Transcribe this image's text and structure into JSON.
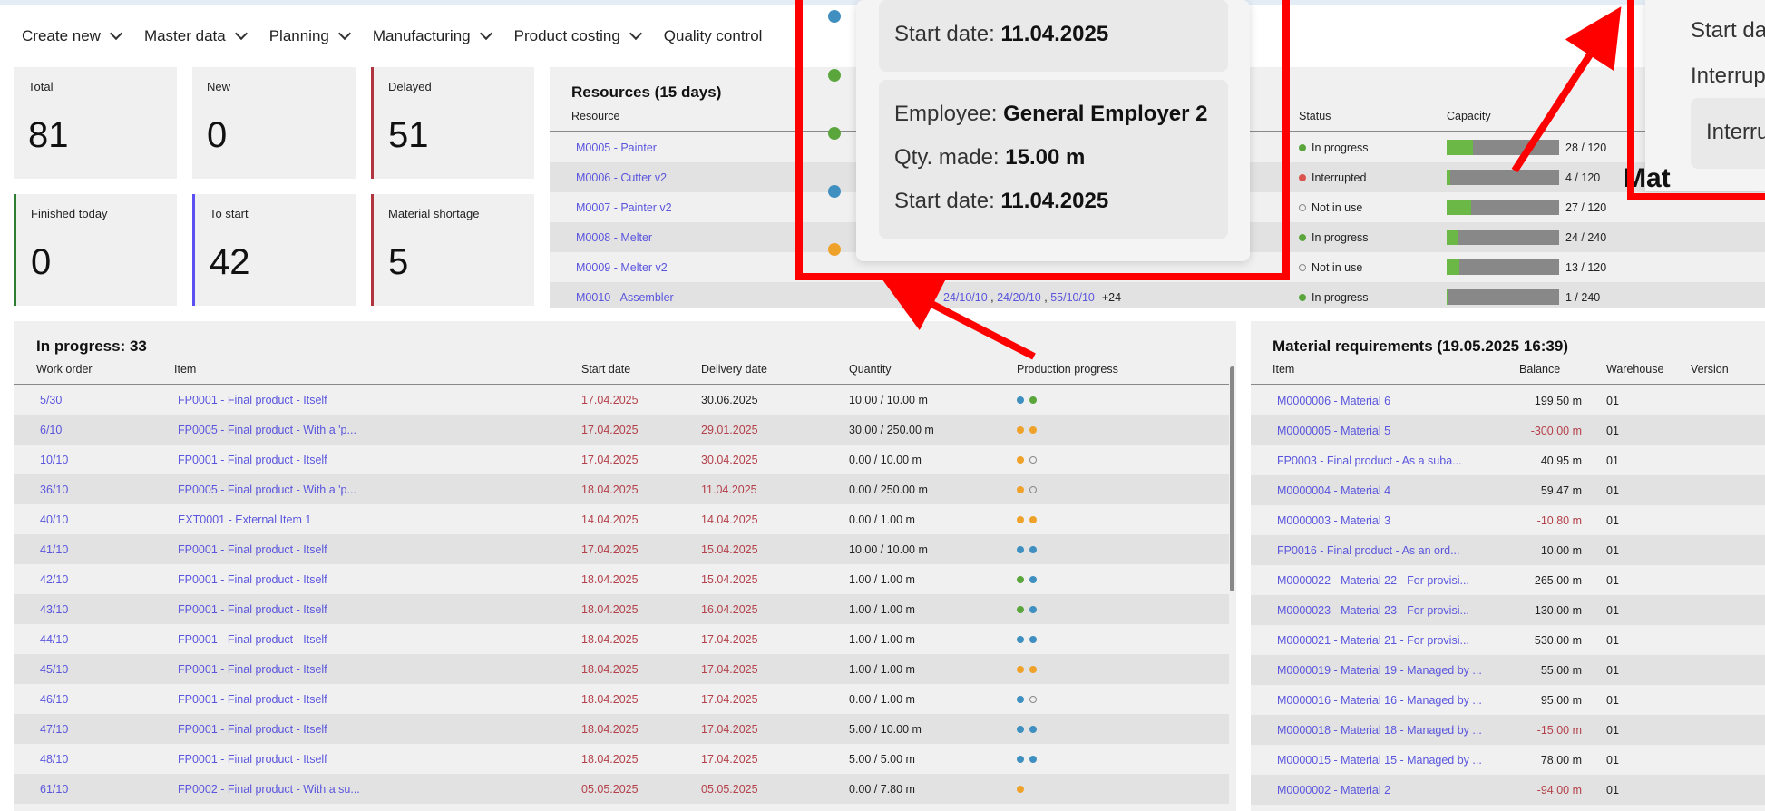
{
  "nav": {
    "items": [
      {
        "label": "Create new"
      },
      {
        "label": "Master data"
      },
      {
        "label": "Planning"
      },
      {
        "label": "Manufacturing"
      },
      {
        "label": "Product costing"
      },
      {
        "label": "Quality control"
      }
    ]
  },
  "kpis": {
    "total": {
      "label": "Total",
      "value": "81"
    },
    "new": {
      "label": "New",
      "value": "0"
    },
    "delayed": {
      "label": "Delayed",
      "value": "51"
    },
    "finished_today": {
      "label": "Finished today",
      "value": "0"
    },
    "to_start": {
      "label": "To start",
      "value": "42"
    },
    "material_shortage": {
      "label": "Material shortage",
      "value": "5"
    }
  },
  "resources": {
    "title": "Resources (15 days)",
    "headers": {
      "resource": "Resource",
      "status": "Status",
      "capacity": "Capacity"
    },
    "rows": [
      {
        "name": "M0005 - Painter",
        "status": "In progress",
        "status_color": "green",
        "capacity": "28 / 120",
        "fill": 0.23
      },
      {
        "name": "M0006 - Cutter v2",
        "status": "Interrupted",
        "status_color": "red",
        "capacity": "4 / 120",
        "fill": 0.03
      },
      {
        "name": "M0007 - Painter v2",
        "status": "Not in use",
        "status_color": "empty",
        "capacity": "27 / 120",
        "fill": 0.22
      },
      {
        "name": "M0008 - Melter",
        "status": "In progress",
        "status_color": "green",
        "capacity": "24 / 240",
        "fill": 0.1
      },
      {
        "name": "M0009 - Melter v2",
        "status": "Not in use",
        "status_color": "empty",
        "capacity": "13 / 120",
        "fill": 0.11
      },
      {
        "name": "M0010 - Assembler",
        "status": "In progress",
        "status_color": "green",
        "capacity": "1 / 240",
        "fill": 0.004
      }
    ],
    "last_row_orders": [
      "24/10/10",
      "24/20/10",
      "55/10/10"
    ],
    "last_row_more": "+24"
  },
  "in_progress": {
    "title": "In progress: 33",
    "headers": {
      "work_order": "Work order",
      "item": "Item",
      "start_date": "Start date",
      "delivery_date": "Delivery date",
      "quantity": "Quantity",
      "progress": "Production progress"
    },
    "rows": [
      {
        "wo": "5/30",
        "item": "FP0001 - Final product - Itself",
        "start": "17.04.2025",
        "start_red": true,
        "delivery": "30.06.2025",
        "delivery_red": false,
        "qty": "10.00 / 10.00 m",
        "dots": [
          "blue",
          "green"
        ]
      },
      {
        "wo": "6/10",
        "item": "FP0005 - Final product - With a 'p...",
        "start": "17.04.2025",
        "start_red": true,
        "delivery": "29.01.2025",
        "delivery_red": true,
        "qty": "30.00 / 250.00 m",
        "dots": [
          "orange",
          "orange"
        ]
      },
      {
        "wo": "10/10",
        "item": "FP0001 - Final product - Itself",
        "start": "17.04.2025",
        "start_red": true,
        "delivery": "30.04.2025",
        "delivery_red": true,
        "qty": "0.00 / 10.00 m",
        "dots": [
          "orange",
          "empty"
        ]
      },
      {
        "wo": "36/10",
        "item": "FP0005 - Final product - With a 'p...",
        "start": "18.04.2025",
        "start_red": true,
        "delivery": "11.04.2025",
        "delivery_red": true,
        "qty": "0.00 / 250.00 m",
        "dots": [
          "orange",
          "empty"
        ]
      },
      {
        "wo": "40/10",
        "item": "EXT0001 - External Item 1",
        "start": "14.04.2025",
        "start_red": true,
        "delivery": "14.04.2025",
        "delivery_red": true,
        "qty": "0.00 / 1.00 m",
        "dots": [
          "orange",
          "orange"
        ]
      },
      {
        "wo": "41/10",
        "item": "FP0001 - Final product - Itself",
        "start": "17.04.2025",
        "start_red": true,
        "delivery": "15.04.2025",
        "delivery_red": true,
        "qty": "10.00 / 10.00 m",
        "dots": [
          "blue",
          "blue"
        ]
      },
      {
        "wo": "42/10",
        "item": "FP0001 - Final product - Itself",
        "start": "18.04.2025",
        "start_red": true,
        "delivery": "15.04.2025",
        "delivery_red": true,
        "qty": "1.00 / 1.00 m",
        "dots": [
          "green",
          "blue"
        ]
      },
      {
        "wo": "43/10",
        "item": "FP0001 - Final product - Itself",
        "start": "18.04.2025",
        "start_red": true,
        "delivery": "16.04.2025",
        "delivery_red": true,
        "qty": "1.00 / 1.00 m",
        "dots": [
          "green",
          "blue"
        ]
      },
      {
        "wo": "44/10",
        "item": "FP0001 - Final product - Itself",
        "start": "18.04.2025",
        "start_red": true,
        "delivery": "17.04.2025",
        "delivery_red": true,
        "qty": "1.00 / 1.00 m",
        "dots": [
          "blue",
          "blue"
        ]
      },
      {
        "wo": "45/10",
        "item": "FP0001 - Final product - Itself",
        "start": "18.04.2025",
        "start_red": true,
        "delivery": "17.04.2025",
        "delivery_red": true,
        "qty": "1.00 / 1.00 m",
        "dots": [
          "orange",
          "orange"
        ]
      },
      {
        "wo": "46/10",
        "item": "FP0001 - Final product - Itself",
        "start": "18.04.2025",
        "start_red": true,
        "delivery": "17.04.2025",
        "delivery_red": true,
        "qty": "0.00 / 1.00 m",
        "dots": [
          "blue",
          "empty"
        ]
      },
      {
        "wo": "47/10",
        "item": "FP0001 - Final product - Itself",
        "start": "18.04.2025",
        "start_red": true,
        "delivery": "17.04.2025",
        "delivery_red": true,
        "qty": "5.00 / 10.00 m",
        "dots": [
          "blue",
          "blue"
        ]
      },
      {
        "wo": "48/10",
        "item": "FP0001 - Final product - Itself",
        "start": "18.04.2025",
        "start_red": true,
        "delivery": "17.04.2025",
        "delivery_red": true,
        "qty": "5.00 / 5.00 m",
        "dots": [
          "blue",
          "blue"
        ]
      },
      {
        "wo": "61/10",
        "item": "FP0002 - Final product - With a su...",
        "start": "05.05.2025",
        "start_red": true,
        "delivery": "05.05.2025",
        "delivery_red": true,
        "qty": "0.00 / 7.80 m",
        "dots": [
          "orange"
        ]
      }
    ]
  },
  "materials": {
    "title": "Material requirements (19.05.2025 16:39)",
    "headers": {
      "item": "Item",
      "balance": "Balance",
      "warehouse": "Warehouse",
      "version": "Version"
    },
    "rows": [
      {
        "item": "M0000006 - Material 6",
        "balance": "199.50 m",
        "neg": false,
        "wh": "01"
      },
      {
        "item": "M0000005 - Material 5",
        "balance": "-300.00 m",
        "neg": true,
        "wh": "01"
      },
      {
        "item": "FP0003 - Final product - As a suba...",
        "balance": "40.95 m",
        "neg": false,
        "wh": "01"
      },
      {
        "item": "M0000004 - Material 4",
        "balance": "59.47 m",
        "neg": false,
        "wh": "01"
      },
      {
        "item": "M0000003 - Material 3",
        "balance": "-10.80 m",
        "neg": true,
        "wh": "01"
      },
      {
        "item": "FP0016 - Final product - As an ord...",
        "balance": "10.00 m",
        "neg": false,
        "wh": "01"
      },
      {
        "item": "M0000022 - Material 22 - For provisi...",
        "balance": "265.00 m",
        "neg": false,
        "wh": "01"
      },
      {
        "item": "M0000023 - Material 23 - For provisi...",
        "balance": "130.00 m",
        "neg": false,
        "wh": "01"
      },
      {
        "item": "M0000021 - Material 21 - For provisi...",
        "balance": "530.00 m",
        "neg": false,
        "wh": "01"
      },
      {
        "item": "M0000019 - Material 19 - Managed by ...",
        "balance": "55.00 m",
        "neg": false,
        "wh": "01"
      },
      {
        "item": "M0000016 - Material 16 - Managed by ...",
        "balance": "95.00 m",
        "neg": false,
        "wh": "01"
      },
      {
        "item": "M0000018 - Material 18 - Managed by ...",
        "balance": "-15.00 m",
        "neg": true,
        "wh": "01"
      },
      {
        "item": "M0000015 - Material 15 - Managed by ...",
        "balance": "78.00 m",
        "neg": false,
        "wh": "01"
      },
      {
        "item": "M0000002 - Material 2",
        "balance": "-94.00 m",
        "neg": true,
        "wh": "01"
      }
    ]
  },
  "tooltip_center": {
    "card1": {
      "start_label": "Start date:",
      "start_value": "11.04.2025"
    },
    "card2": {
      "emp_label": "Employee:",
      "emp_value": "General Employer 2",
      "qty_label": "Qty. made:",
      "qty_value": "15.00 m",
      "start_label": "Start date:",
      "start_value": "11.04.2025"
    },
    "dot_colors": [
      "blue",
      "green",
      "green",
      "blue",
      "orange"
    ]
  },
  "tooltip_right": {
    "start_label": "Start da",
    "interrupt_label": "Interrup",
    "card_label": "Interru",
    "bg_text": "Mat"
  },
  "colors": {
    "accent_link": "#5a55dd",
    "negative": "#b3404a",
    "highlight": "#ff0000"
  }
}
